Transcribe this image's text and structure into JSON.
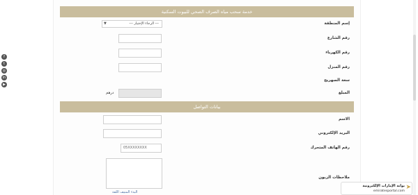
{
  "sections": [
    {
      "title": "خدمة سحب مياه الصرف الصحي للبيوت السكنية"
    },
    {
      "title": "بيانات التواصل"
    }
  ],
  "fields": {
    "region": {
      "label": "إسم المنطقة",
      "value": "--- الرجاء الإختيار ---"
    },
    "street": {
      "label": "رقم الشارع",
      "value": ""
    },
    "electricity": {
      "label": "رقم الكهرباء",
      "value": ""
    },
    "house": {
      "label": "رقم المنزل",
      "value": ""
    },
    "tank_capacity": {
      "label": "سعة الصهريج"
    },
    "amount": {
      "label": "المبلغ",
      "value": "",
      "currency": "درهم"
    },
    "name": {
      "label": "الاسم",
      "value": ""
    },
    "email": {
      "label": "البريد الإلكتروني",
      "value": ""
    },
    "mobile": {
      "label": "رقم الهاتف المتحرك",
      "placeholder": "05XXXXXXXX"
    },
    "notes": {
      "label": "ملاحظات الزبون",
      "value": ""
    }
  },
  "footer_link": "البدء المنيف اللفة",
  "logo": {
    "title": "بوابة الإمارات الإلكترونية",
    "url": "emiratesportal.com"
  },
  "colors": {
    "header_bar": "#c9bd9d",
    "link": "#4a6fa5"
  }
}
